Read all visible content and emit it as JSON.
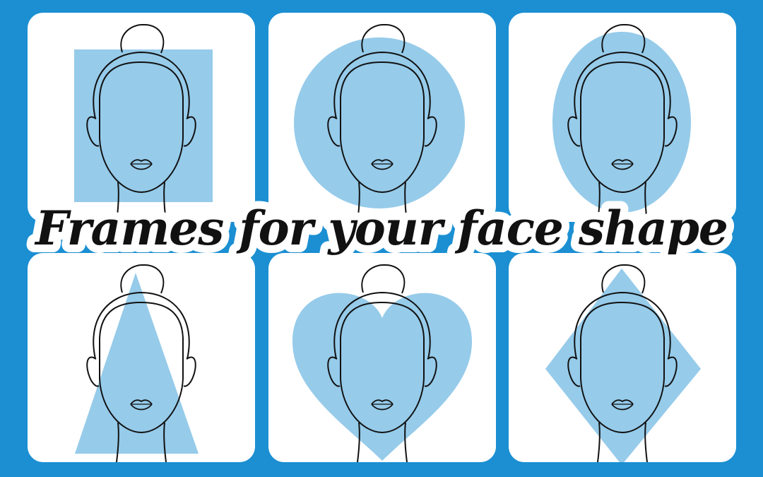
{
  "title": "Frames for your face shape",
  "colors": {
    "background": "#1b8fd2",
    "card": "#ffffff",
    "shape": "#96cbea",
    "line": "#111111"
  },
  "cards": [
    {
      "shape": "square-icon"
    },
    {
      "shape": "round-icon"
    },
    {
      "shape": "oval-icon"
    },
    {
      "shape": "triangle-icon"
    },
    {
      "shape": "heart-icon"
    },
    {
      "shape": "diamond-icon"
    }
  ]
}
